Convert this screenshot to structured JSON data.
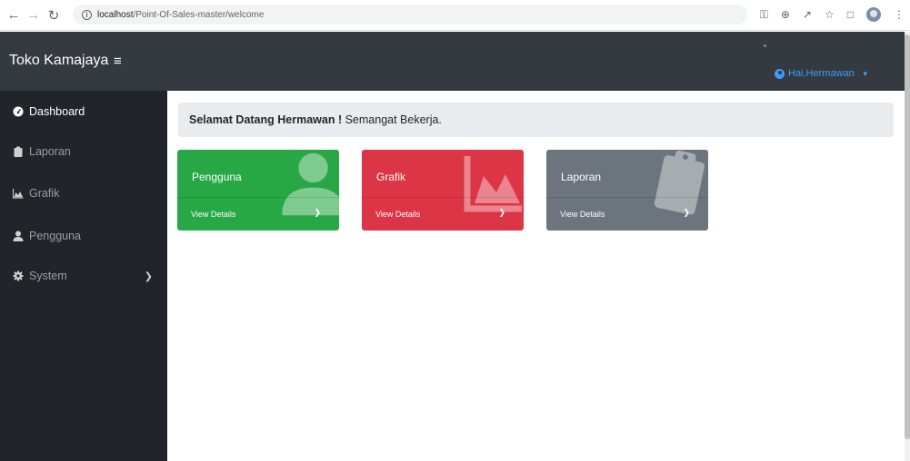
{
  "browser": {
    "url_host": "localhost",
    "url_path": "/Point-Of-Sales-master/welcome"
  },
  "navbar": {
    "brand": "Toko Kamajaya",
    "user_label": "Hai,Hermawan"
  },
  "sidebar": {
    "items": [
      {
        "label": "Dashboard",
        "icon": "dashboard-icon"
      },
      {
        "label": "Laporan",
        "icon": "clipboard-icon"
      },
      {
        "label": "Grafik",
        "icon": "area-chart-icon"
      },
      {
        "label": "Pengguna",
        "icon": "user-icon"
      },
      {
        "label": "System",
        "icon": "gear-icon"
      }
    ]
  },
  "welcome": {
    "bold": "Selamat Datang Hermawan !",
    "text": " Semangat Bekerja."
  },
  "cards": [
    {
      "title": "Pengguna",
      "footer": "View Details",
      "color": "#28a745"
    },
    {
      "title": "Grafik",
      "footer": "View Details",
      "color": "#dc3545"
    },
    {
      "title": "Laporan",
      "footer": "View Details",
      "color": "#6c757d"
    }
  ],
  "colors": {
    "navbar": "#343a40",
    "sidebar": "#212529",
    "link": "#3f9bff"
  }
}
